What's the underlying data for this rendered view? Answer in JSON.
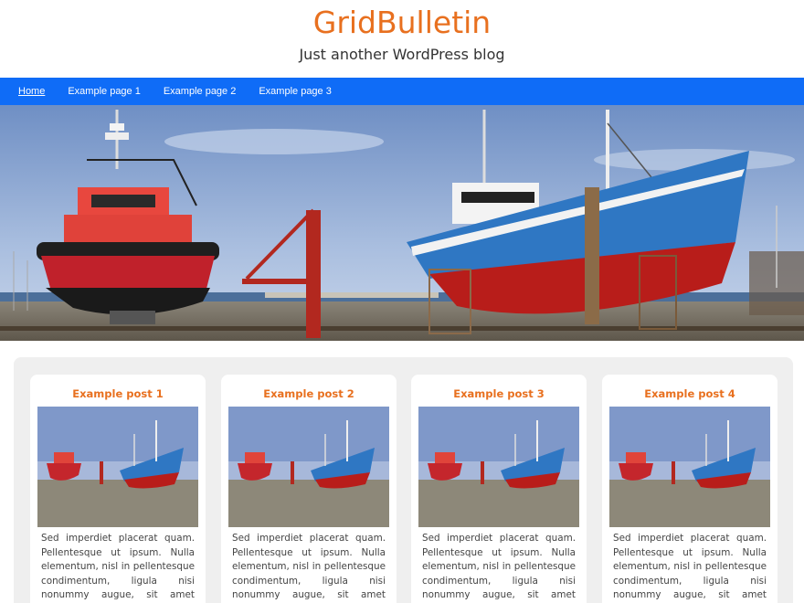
{
  "site": {
    "title": "GridBulletin",
    "tagline": "Just another WordPress blog"
  },
  "nav": {
    "items": [
      {
        "label": "Home",
        "current": true
      },
      {
        "label": "Example page 1",
        "current": false
      },
      {
        "label": "Example page 2",
        "current": false
      },
      {
        "label": "Example page 3",
        "current": false
      }
    ]
  },
  "posts": [
    {
      "title": "Example post 1",
      "excerpt": "Sed imperdiet placerat quam. Pellentesque ut ipsum. Nulla elementum, nisl in pellentesque condimentum, ligula nisi nonummy augue, sit amet ornare"
    },
    {
      "title": "Example post 2",
      "excerpt": "Sed imperdiet placerat quam. Pellentesque ut ipsum. Nulla elementum, nisl in pellentesque condimentum, ligula nisi nonummy augue, sit amet ornare"
    },
    {
      "title": "Example post 3",
      "excerpt": "Sed imperdiet placerat quam. Pellentesque ut ipsum. Nulla elementum, nisl in pellentesque condimentum, ligula nisi nonummy augue, sit amet ornare"
    },
    {
      "title": "Example post 4",
      "excerpt": "Sed imperdiet placerat quam. Pellentesque ut ipsum. Nulla elementum, nisl in pellentesque condimentum, ligula nisi nonummy augue, sit amet ornare"
    }
  ],
  "colors": {
    "accent": "#e8701f",
    "nav_bg": "#0f6cf7",
    "content_bg": "#efefef"
  }
}
